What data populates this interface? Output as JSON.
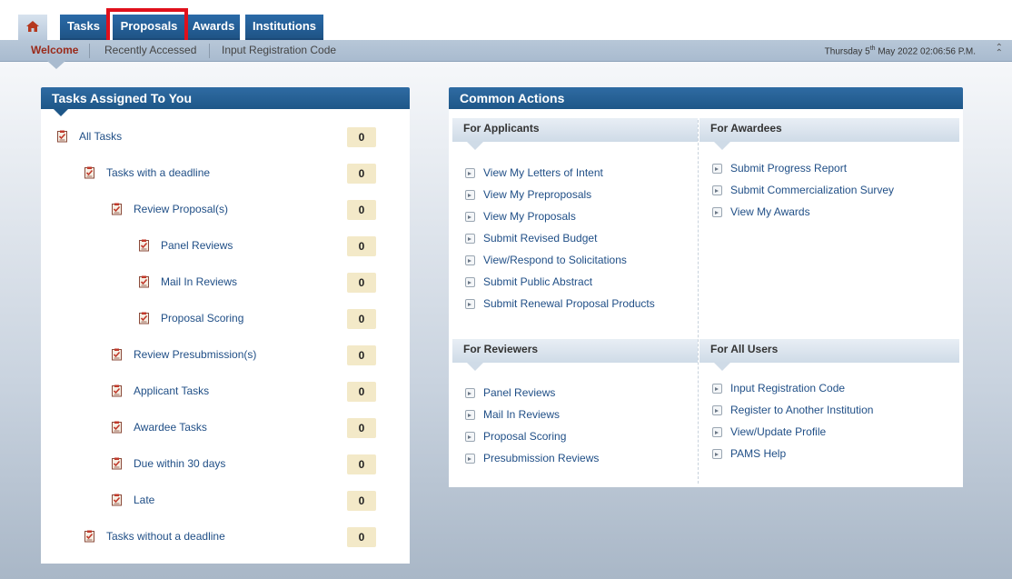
{
  "top_tabs": [
    {
      "label": "Tasks"
    },
    {
      "label": "Proposals"
    },
    {
      "label": "Awards"
    },
    {
      "label": "Institutions"
    }
  ],
  "sub_nav": {
    "welcome": "Welcome",
    "recently_accessed": "Recently Accessed",
    "input_registration_code": "Input Registration Code",
    "date_prefix": "Thursday 5",
    "date_sup": "th",
    "date_suffix": " May 2022 02:06:56 P.M."
  },
  "tasks_panel": {
    "title": "Tasks Assigned To You",
    "rows": [
      {
        "label": "All Tasks",
        "count": "0"
      },
      {
        "label": "Tasks with a deadline",
        "count": "0"
      },
      {
        "label": "Review Proposal(s)",
        "count": "0"
      },
      {
        "label": "Panel Reviews",
        "count": "0"
      },
      {
        "label": "Mail In Reviews",
        "count": "0"
      },
      {
        "label": "Proposal Scoring",
        "count": "0"
      },
      {
        "label": "Review Presubmission(s)",
        "count": "0"
      },
      {
        "label": "Applicant Tasks",
        "count": "0"
      },
      {
        "label": "Awardee Tasks",
        "count": "0"
      },
      {
        "label": "Due within 30 days",
        "count": "0"
      },
      {
        "label": "Late",
        "count": "0"
      },
      {
        "label": "Tasks without a deadline",
        "count": "0"
      }
    ]
  },
  "common_actions": {
    "title": "Common Actions",
    "applicants": {
      "heading": "For Applicants",
      "links": [
        "View My Letters of Intent",
        "View My Preproposals",
        "View My Proposals",
        "Submit Revised Budget",
        "View/Respond to Solicitations",
        "Submit Public Abstract",
        "Submit Renewal Proposal Products"
      ]
    },
    "awardees": {
      "heading": "For Awardees",
      "links": [
        "Submit Progress Report",
        "Submit Commercialization Survey",
        "View My Awards"
      ]
    },
    "reviewers": {
      "heading": "For Reviewers",
      "links": [
        "Panel Reviews",
        "Mail In Reviews",
        "Proposal Scoring",
        "Presubmission Reviews"
      ]
    },
    "all_users": {
      "heading": "For All Users",
      "links": [
        "Input Registration Code",
        "Register to Another Institution",
        "View/Update Profile",
        "PAMS Help"
      ]
    }
  }
}
